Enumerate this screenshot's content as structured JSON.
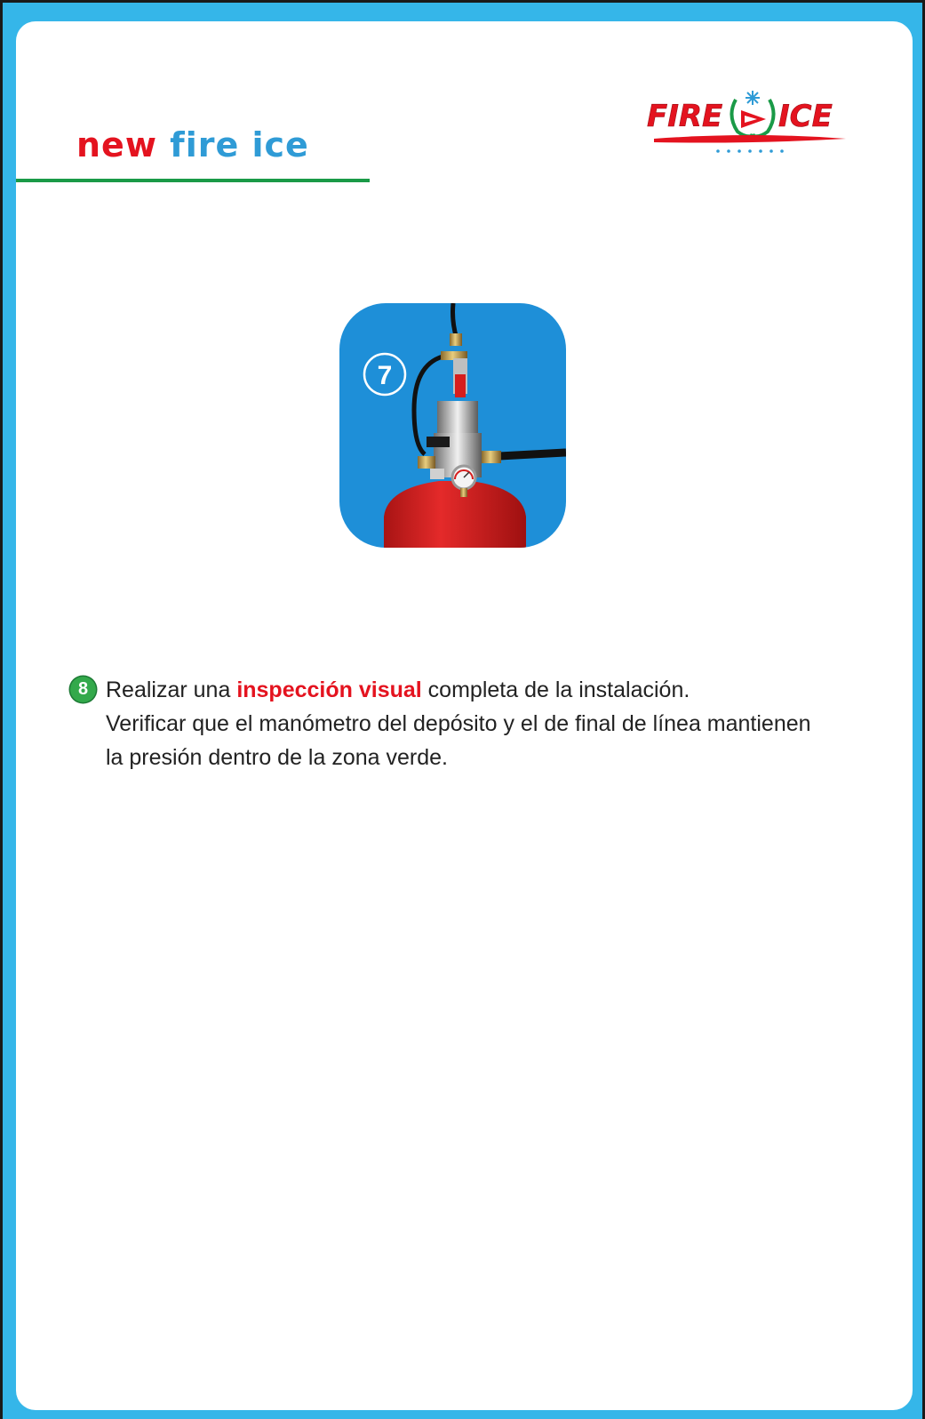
{
  "header": {
    "title_word1": "new",
    "title_word2": "fire ice",
    "logo": {
      "text_left": "FIRE",
      "text_right": "ICE",
      "icon": "fire-ice-logo-icon"
    }
  },
  "photo": {
    "badge": "7",
    "subject": "extinguisher-valve-icon"
  },
  "step": {
    "number": "8",
    "line1_before": "Realizar una ",
    "line1_highlight": "inspección visual",
    "line1_after": " completa de la instalación.",
    "line2": "Verificar que el manómetro del depósito y el de final de línea mantienen",
    "line3": "la presión dentro de la zona verde."
  },
  "colors": {
    "frame_blue": "#35b6e9",
    "title_red": "#e4131f",
    "title_blue": "#2f9bd6",
    "rule_green": "#1a9a47",
    "badge_green": "#33a94b",
    "cylinder_red": "#d91e1e"
  }
}
